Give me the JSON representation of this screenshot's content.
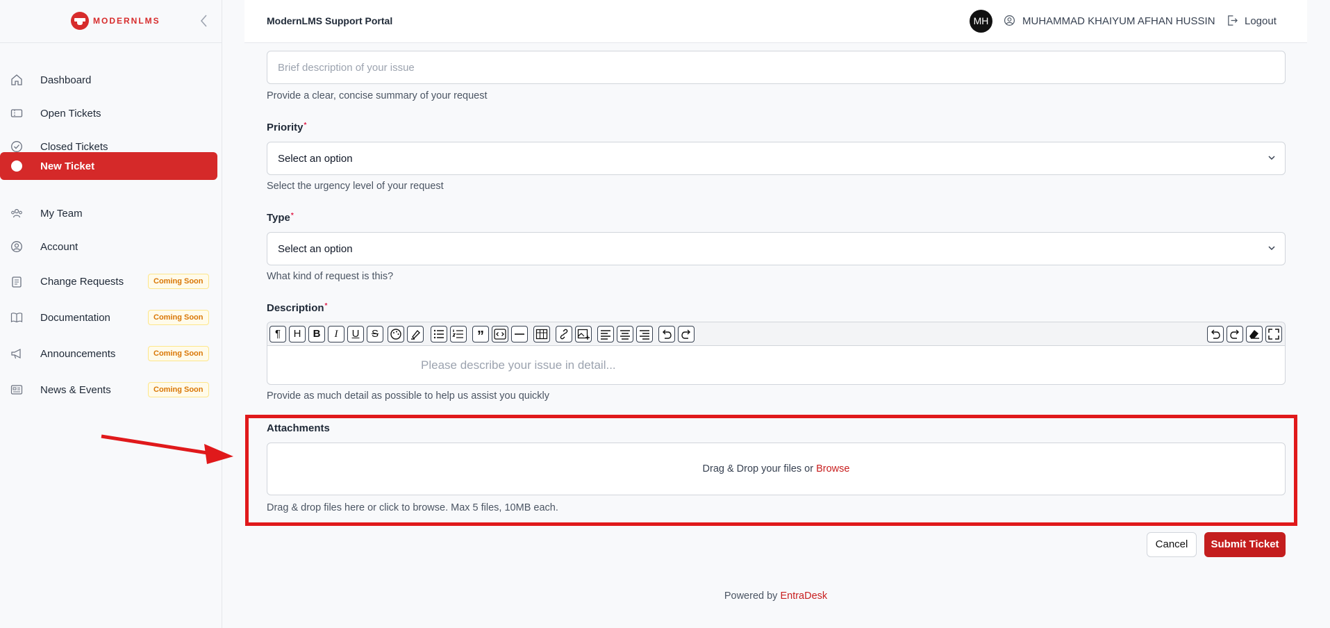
{
  "brand": {
    "logo_text": "MODERNLMS"
  },
  "sidebar": {
    "items": [
      {
        "label": "Dashboard",
        "icon": "home-icon"
      },
      {
        "label": "Open Tickets",
        "icon": "ticket-icon"
      },
      {
        "label": "Closed Tickets",
        "icon": "check-circle-icon"
      },
      {
        "label": "New Ticket",
        "icon": "plus-circle-icon",
        "active": true
      },
      {
        "label": "My Team",
        "icon": "team-icon"
      },
      {
        "label": "Account",
        "icon": "user-circle-icon"
      },
      {
        "label": "Change Requests",
        "icon": "clipboard-icon",
        "badge": "Coming Soon"
      },
      {
        "label": "Documentation",
        "icon": "book-icon",
        "badge": "Coming Soon"
      },
      {
        "label": "Announcements",
        "icon": "megaphone-icon",
        "badge": "Coming Soon"
      },
      {
        "label": "News & Events",
        "icon": "newspaper-icon",
        "badge": "Coming Soon"
      }
    ]
  },
  "header": {
    "title": "ModernLMS Support Portal",
    "avatar_initials": "MH",
    "user_name": "MUHAMMAD KHAIYUM AFHAN HUSSIN",
    "logout_label": "Logout"
  },
  "form": {
    "subject": {
      "placeholder": "Brief description of your issue",
      "help": "Provide a clear, concise summary of your request"
    },
    "priority": {
      "label": "Priority",
      "required_mark": "*",
      "value": "Select an option",
      "help": "Select the urgency level of your request"
    },
    "type": {
      "label": "Type",
      "required_mark": "*",
      "value": "Select an option",
      "help": "What kind of request is this?"
    },
    "description": {
      "label": "Description",
      "required_mark": "*",
      "placeholder": "Please describe your issue in detail...",
      "help": "Provide as much detail as possible to help us assist you quickly"
    },
    "attachments": {
      "label": "Attachments",
      "drop_text": "Drag & Drop your files or ",
      "browse": "Browse",
      "help": "Drag & drop files here or click to browse. Max 5 files, 10MB each."
    },
    "cancel_label": "Cancel",
    "submit_label": "Submit Ticket"
  },
  "footer": {
    "powered_by": "Powered by ",
    "brand": "EntraDesk"
  },
  "colors": {
    "accent": "#d52929",
    "highlight": "#e0191b",
    "badge_text": "#d97706"
  }
}
